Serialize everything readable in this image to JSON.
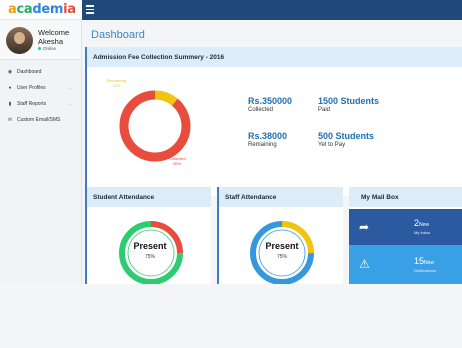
{
  "brand": {
    "logo_text_1": "a",
    "logo_text_2": "ca",
    "logo_text_3": "dem",
    "logo_text_4": "ia"
  },
  "user": {
    "welcome": "Welcome",
    "name": "Akesha",
    "status": "Online"
  },
  "sidebar": {
    "items": [
      {
        "label": "Dashboard",
        "icon": "dashboard-icon",
        "arrow": ""
      },
      {
        "label": "User Profiles",
        "icon": "users-icon",
        "arrow": "‹"
      },
      {
        "label": "Staff Reports",
        "icon": "chart-icon",
        "arrow": "‹"
      },
      {
        "label": "Custom Email/SMS",
        "icon": "envelope-icon",
        "arrow": ""
      }
    ]
  },
  "page": {
    "title": "Dashboard"
  },
  "fee": {
    "title": "Admission Fee Collection Summery - 2016",
    "collected_amount": "Rs.350000",
    "collected_label": "Collected",
    "remaining_amount": "Rs.38000",
    "remaining_label": "Remaining",
    "paid_students": "1500 Students",
    "paid_label": "Paid",
    "pending_students": "500 Students",
    "pending_label": "Yet to Pay",
    "donut": {
      "remaining_label": "Remaining",
      "remaining_pct_label": "11%",
      "collected_label": "Collected",
      "collected_pct_label": "89%",
      "remaining_fraction": 0.11,
      "collected_fraction": 0.89,
      "colors": {
        "collected": "#e74c3c",
        "remaining": "#f1c40f"
      }
    }
  },
  "student_attendance": {
    "title": "Student Attendance",
    "label": "Present",
    "value_label": "75%",
    "fraction": 0.75,
    "colors": {
      "present": "#2ecc71",
      "absent": "#e74c3c"
    }
  },
  "staff_attendance": {
    "title": "Staff Attendance",
    "label": "Present",
    "value_label": "75%",
    "fraction": 0.75,
    "colors": {
      "present": "#3498db",
      "absent": "#f1c40f"
    }
  },
  "mailbox": {
    "title": "My Mail Box",
    "inbox": {
      "count": "2",
      "new": "New",
      "label": "My Inbox",
      "color": "#2c5aa0",
      "icon": "share-arrow-icon"
    },
    "notifications": {
      "count": "15",
      "new": "New",
      "label": "Notifications",
      "color": "#3aa0e6",
      "icon": "warning-icon"
    }
  },
  "colors": {
    "topbar": "#214a7b",
    "accent": "#3b86c8"
  }
}
